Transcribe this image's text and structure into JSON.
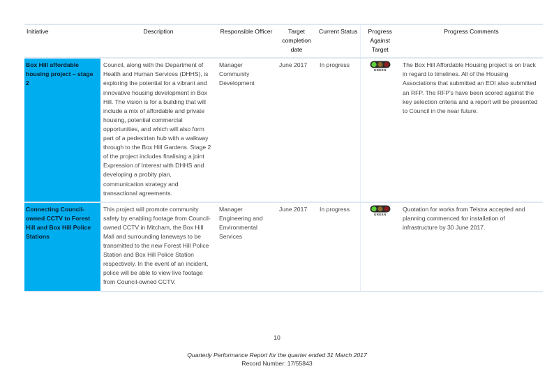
{
  "table": {
    "headers": [
      "Initiative",
      "Description",
      "Responsible Officer",
      "Target completion date",
      "Current Status",
      "Progress Against Target",
      "Progress Comments"
    ],
    "rows": [
      {
        "initiative": "Box Hill affordable housing project – stage 2",
        "description": "Council, along with the Department of Health and Human Services (DHHS), is exploring the potential for a vibrant and innovative housing development in Box Hill. The vision is for a building that will include a mix of affordable and private housing, potential commercial opportunities, and which will also form part of a pedestrian hub with a walkway through to the Box Hill Gardens. Stage 2 of the project includes finalising a joint Expression of Interest with DHHS and developing a probity plan, communication strategy and transactional agreements.",
        "officer": "Manager Community Development",
        "target_date": "June 2017",
        "status": "In progress",
        "progress": {
          "indicator": "traffic-light-icon",
          "active": "green",
          "label": "GREEN"
        },
        "comments": "The Box Hill Affordable Housing project is on track in regard to timelines. All of the Housing Associations that submitted an EOI also submitted an RFP. The RFP's have been scored against the key selection criteria and a report will be presented to Council in the near future."
      },
      {
        "initiative": "Connecting Council-owned CCTV to Forest Hill and Box Hill Police Stations",
        "description": "This project will promote community safety by enabling footage from Council-owned CCTV in Mitcham, the Box Hill Mall and surrounding laneways to be transmitted to the new Forest Hill Police Station and Box Hill Police Station respectively. In the event of an incident, police will be able to view live footage from Council-owned CCTV.",
        "officer": "Manager Engineering and Environmental Services",
        "target_date": "June 2017",
        "status": "In progress",
        "progress": {
          "indicator": "traffic-light-icon",
          "active": "green",
          "label": "GREEN"
        },
        "comments": "Quotation for works from Telstra accepted and planning commenced for installation of infrastructure by 30 June 2017."
      }
    ]
  },
  "colors": {
    "initiative_cell": "#00aeef",
    "rule": "#dde8f2",
    "light_green": "#5fd13a",
    "light_amber_dim": "#8a6a2a",
    "light_red_dim": "#8a1f1f"
  },
  "footer": {
    "page_number": "10",
    "report_title": "Quarterly Performance Report for the quarter ended 31 March 2017",
    "record_number": "Record Number: 17/55843"
  }
}
